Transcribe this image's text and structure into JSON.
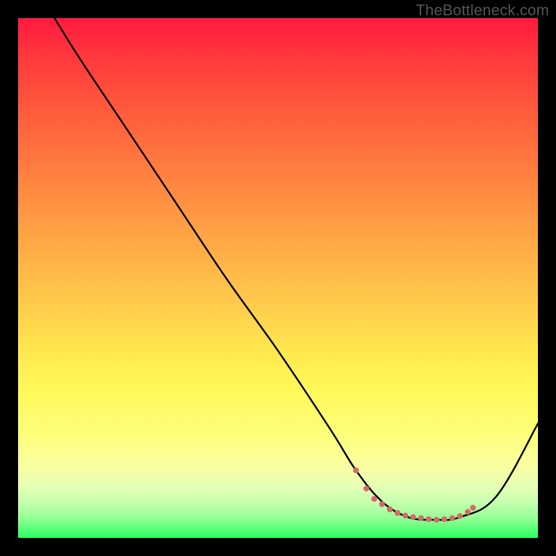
{
  "watermark": "TheBottleneck.com",
  "gradient": {
    "top_color": "#ff1a3f",
    "mid_color": "#ffe84f",
    "bottom_color": "#2aff60"
  },
  "chart_data": {
    "type": "line",
    "title": "",
    "xlabel": "",
    "ylabel": "",
    "xlim": [
      0,
      100
    ],
    "ylim": [
      0,
      100
    ],
    "series": [
      {
        "name": "bottleneck-curve",
        "x": [
          7,
          12,
          20,
          30,
          40,
          50,
          60,
          65,
          70,
          75,
          80,
          85,
          92,
          100
        ],
        "y": [
          100,
          92,
          80,
          65,
          50,
          36,
          21,
          13,
          7,
          4,
          3.5,
          4,
          8,
          22
        ],
        "color": "#000000",
        "line_width": 2.5
      }
    ],
    "markers": {
      "name": "optimal-range-markers",
      "color": "#d46a6a",
      "radius": 4.2,
      "points": [
        {
          "x": 65,
          "y": 13
        },
        {
          "x": 67,
          "y": 9.5
        },
        {
          "x": 68.5,
          "y": 7.5
        },
        {
          "x": 70,
          "y": 6.5
        },
        {
          "x": 71.5,
          "y": 5.5
        },
        {
          "x": 73,
          "y": 4.8
        },
        {
          "x": 74.5,
          "y": 4.3
        },
        {
          "x": 76,
          "y": 4.0
        },
        {
          "x": 77.5,
          "y": 3.8
        },
        {
          "x": 79,
          "y": 3.6
        },
        {
          "x": 80.5,
          "y": 3.5
        },
        {
          "x": 82,
          "y": 3.6
        },
        {
          "x": 83.5,
          "y": 3.8
        },
        {
          "x": 85,
          "y": 4.2
        },
        {
          "x": 86.5,
          "y": 5.0
        },
        {
          "x": 87.5,
          "y": 5.8
        }
      ]
    }
  }
}
